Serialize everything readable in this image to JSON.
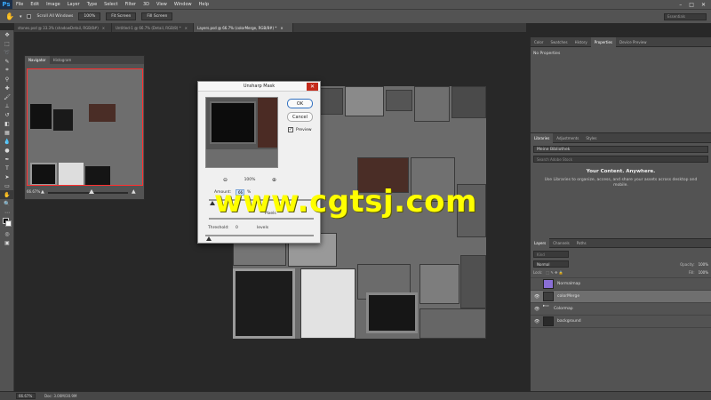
{
  "app": {
    "logo": "Ps"
  },
  "menu": [
    "File",
    "Edit",
    "Image",
    "Layer",
    "Type",
    "Select",
    "Filter",
    "3D",
    "View",
    "Window",
    "Help"
  ],
  "window_controls": [
    "–",
    "□",
    "✕"
  ],
  "options": {
    "scroll_all_windows": "Scroll All Windows",
    "zoom_100": "100%",
    "fit_screen": "Fit Screen",
    "fill_screen": "Fill Screen",
    "workspace": "Essentials"
  },
  "doc_tabs": [
    {
      "label": "stones.psd @ 33.3% (shadowDetail, RGB/8#)",
      "close": "×"
    },
    {
      "label": "Untitled-1 @ 66.7% (Detail, RGB/8) *",
      "close": "×"
    },
    {
      "label": "Layers.psd @ 66.7% (colorMerge, RGB/8#) *",
      "close": "×"
    }
  ],
  "navigator": {
    "tabs": [
      "Navigator",
      "Histogram"
    ],
    "zoom": "66.67%"
  },
  "dialog": {
    "title": "Unsharp Mask",
    "close": "✕",
    "ok": "OK",
    "cancel": "Cancel",
    "preview_label": "Preview",
    "preview_check": "✓",
    "zoom_out": "⊖",
    "zoom_level": "100%",
    "zoom_in": "⊕",
    "amount_label": "Amount:",
    "amount_value": "66",
    "amount_unit": "%",
    "radius_unit": "Pixels",
    "threshold_label": "Threshold:",
    "threshold_value": "0",
    "threshold_unit": "levels"
  },
  "watermark": "www.cgtsj.com",
  "panels": {
    "top_tabs": [
      "Color",
      "Swatches",
      "History",
      "Properties",
      "Device Preview"
    ],
    "active_top": "Properties",
    "properties_text": "No Properties",
    "lib_tabs": [
      "Libraries",
      "Adjustments",
      "Styles"
    ],
    "library_select": "Meine Bibliothek",
    "library_search": "Search Adobe Stock",
    "library_heading": "Your Content. Anywhere.",
    "library_text": "Use Libraries to organize, access, and share your assets across desktop and mobile.",
    "layer_tabs": [
      "Layers",
      "Channels",
      "Paths"
    ],
    "kind_search": "Kind",
    "blend_mode": "Normal",
    "opacity_label": "Opacity:",
    "opacity_value": "100%",
    "lock_label": "Lock:",
    "fill_label": "Fill:",
    "fill_value": "100%",
    "layers": [
      {
        "name": "Normalmap",
        "eye": "",
        "thumb": "#8a6fd6",
        "selected": false
      },
      {
        "name": "colorMerge",
        "eye": "👁",
        "thumb": "#3d3d3d",
        "selected": true
      },
      {
        "name": "Colormap",
        "eye": "👁",
        "thumb": "folder",
        "selected": false
      },
      {
        "name": "background",
        "eye": "👁",
        "thumb": "#2a2a2a",
        "selected": false
      }
    ]
  },
  "status": {
    "zoom": "66.67%",
    "doc": "Doc: 3.00M/30.9M"
  }
}
